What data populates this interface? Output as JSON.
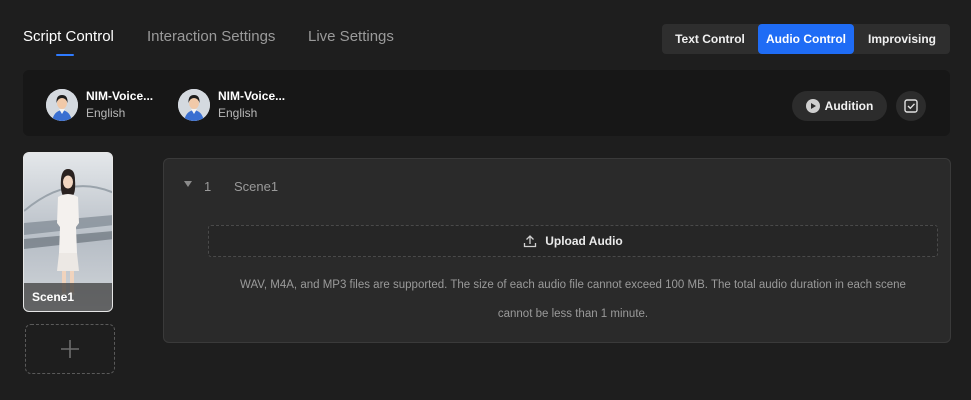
{
  "tabs": [
    {
      "label": "Script Control"
    },
    {
      "label": "Interaction Settings"
    },
    {
      "label": "Live Settings"
    }
  ],
  "modes": {
    "text": "Text Control",
    "audio": "Audio Control",
    "improvising": "Improvising",
    "active": "Audio Control"
  },
  "voices": [
    {
      "name": "NIM-Voice...",
      "language": "English"
    },
    {
      "name": "NIM-Voice...",
      "language": "English"
    }
  ],
  "audition_label": "Audition",
  "scenes": [
    {
      "thumb_label": "Scene1"
    }
  ],
  "scene_panel": {
    "number": "1",
    "name": "Scene1",
    "upload_label": "Upload Audio",
    "hint_line1": "WAV, M4A, and MP3 files are supported. The size of each audio file cannot exceed 100 MB. The total audio duration in each scene",
    "hint_line2": "cannot be less than 1 minute."
  },
  "colors": {
    "accent": "#1f6cf5",
    "background": "#1e1e1e"
  },
  "icons": [
    "play-icon",
    "check-square-icon",
    "caret-down-icon",
    "upload-icon",
    "plus-icon"
  ]
}
